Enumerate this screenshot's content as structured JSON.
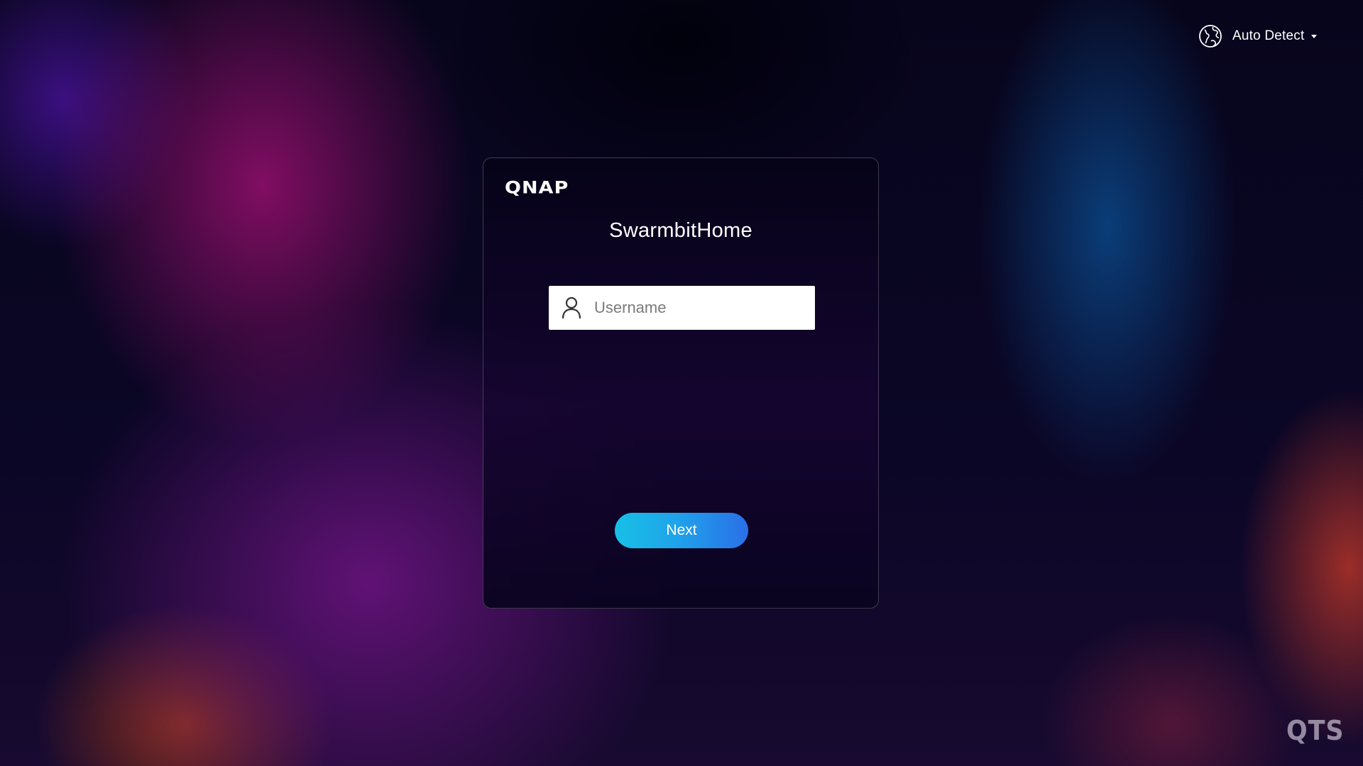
{
  "language_selector": {
    "label": "Auto Detect",
    "icon": "globe-icon"
  },
  "login_card": {
    "brand": "QNAP",
    "device_name": "SwarmbitHome",
    "username": {
      "placeholder": "Username",
      "value": "",
      "icon": "user-icon"
    },
    "next_label": "Next"
  },
  "footer": {
    "os_logo": "QTS"
  },
  "colors": {
    "button_gradient_start": "#17c0e6",
    "button_gradient_end": "#2a6fe8",
    "card_border": "rgba(255,255,255,0.22)"
  }
}
